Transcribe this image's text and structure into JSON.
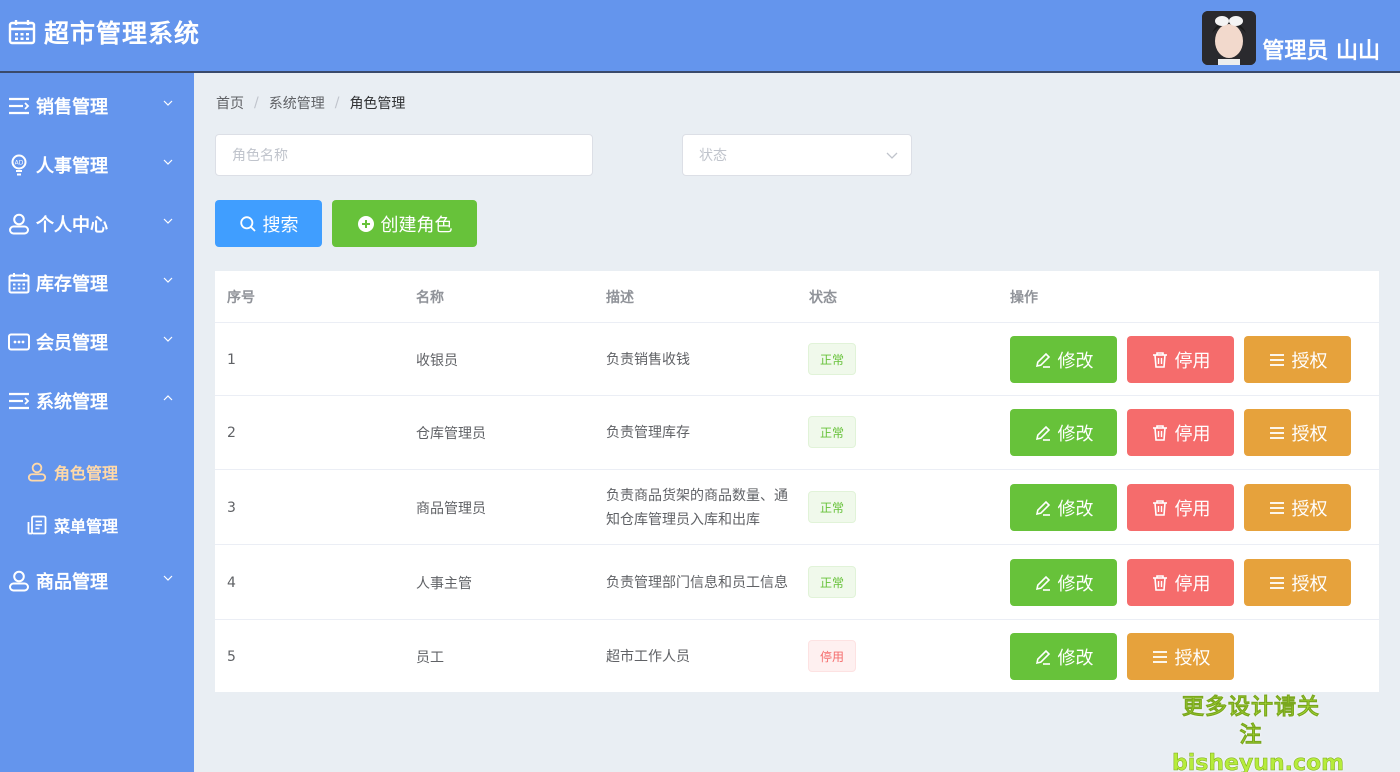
{
  "header": {
    "title": "超市管理系统",
    "user_name": "管理员 山山",
    "logo_icon": "calendar-icon"
  },
  "sidebar": {
    "items": [
      {
        "label": "销售管理",
        "icon": "list-icon"
      },
      {
        "label": "人事管理",
        "icon": "bulb-icon"
      },
      {
        "label": "个人中心",
        "icon": "user-icon"
      },
      {
        "label": "库存管理",
        "icon": "calendar-icon"
      },
      {
        "label": "会员管理",
        "icon": "card-icon"
      },
      {
        "label": "系统管理",
        "icon": "list-icon",
        "expanded": true
      },
      {
        "label": "商品管理",
        "icon": "user-icon"
      }
    ],
    "sub_items": [
      {
        "label": "角色管理",
        "icon": "user-icon",
        "active": true
      },
      {
        "label": "菜单管理",
        "icon": "document-icon"
      }
    ]
  },
  "breadcrumb": [
    "首页",
    "系统管理",
    "角色管理"
  ],
  "filters": {
    "role_name_placeholder": "角色名称",
    "status_placeholder": "状态"
  },
  "actions": {
    "search": "搜索",
    "create": "创建角色"
  },
  "table": {
    "columns": [
      "序号",
      "名称",
      "描述",
      "状态",
      "操作"
    ],
    "rows": [
      {
        "no": "1",
        "name": "收银员",
        "desc": "负责销售收钱",
        "status": "正常"
      },
      {
        "no": "2",
        "name": "仓库管理员",
        "desc": "负责管理库存",
        "status": "正常"
      },
      {
        "no": "3",
        "name": "商品管理员",
        "desc": "负责商品货架的商品数量、通知仓库管理员入库和出库",
        "status": "正常"
      },
      {
        "no": "4",
        "name": "人事主管",
        "desc": "负责管理部门信息和员工信息",
        "status": "正常"
      },
      {
        "no": "5",
        "name": "员工",
        "desc": "超市工作人员",
        "status": "停用"
      }
    ],
    "op_labels": {
      "edit": "修改",
      "disable": "停用",
      "authorize": "授权"
    }
  },
  "watermark": {
    "line1": "更多设计请关注",
    "line2": "bisheyun.com"
  },
  "colors": {
    "primary": "#6495ed",
    "blue": "#409eff",
    "green": "#67c23a",
    "red": "#f56c6c",
    "orange": "#e6a23c"
  }
}
